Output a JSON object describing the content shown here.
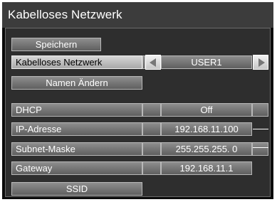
{
  "window": {
    "title": "Kabelloses Netzwerk"
  },
  "buttons": {
    "save": "Speichern",
    "rename": "Namen Ändern",
    "ssid": "SSID"
  },
  "network": {
    "label": "Kabelloses Netzwerk",
    "value": "USER1"
  },
  "settings": [
    {
      "label": "DHCP",
      "value": "Off"
    },
    {
      "label": "IP-Adresse",
      "value": "192.168.11.100"
    },
    {
      "label": "Subnet-Maske",
      "value": "255.255.255. 0"
    },
    {
      "label": "Gateway",
      "value": "192.168.11.1"
    }
  ],
  "icons": {
    "left": "triangle-left-icon",
    "right": "triangle-right-icon"
  },
  "colors": {
    "highlight": "#c8c8c8",
    "button": "#7a7a7a",
    "background": "#2e2e2e"
  }
}
